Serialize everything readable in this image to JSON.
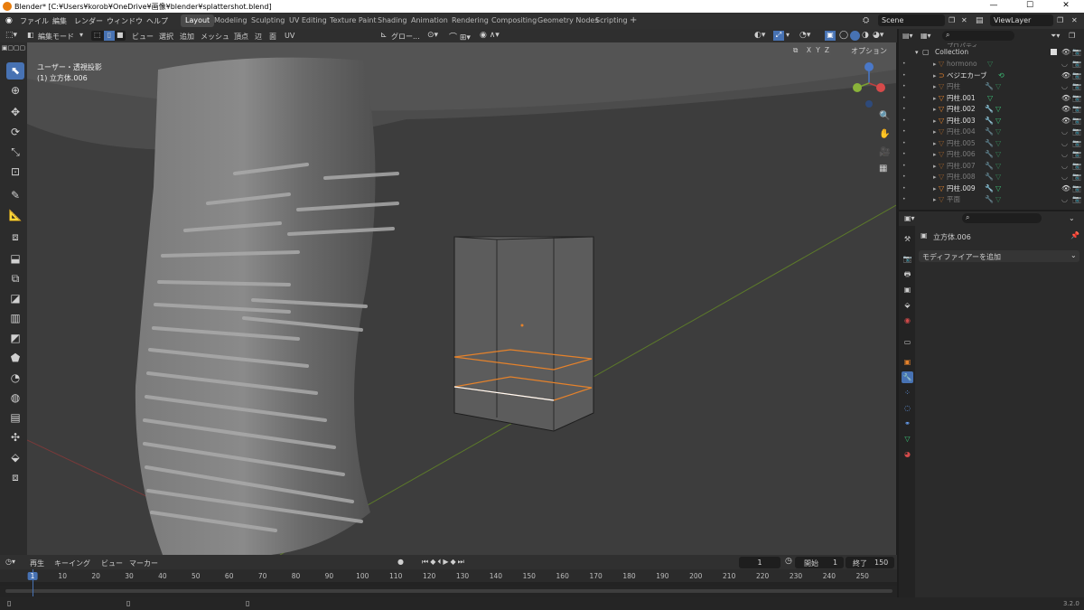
{
  "title": "Blender* [C:¥Users¥korob¥OneDrive¥画像¥blender¥splattershot.blend]",
  "window_controls": [
    "—",
    "☐",
    "✕"
  ],
  "menus": [
    "ファイル",
    "編集",
    "レンダー",
    "ウィンドウ",
    "ヘルプ"
  ],
  "workspaces": [
    "Layout",
    "Modeling",
    "Sculpting",
    "UV Editing",
    "Texture Paint",
    "Shading",
    "Animation",
    "Rendering",
    "Compositing",
    "Geometry Nodes",
    "Scripting",
    "+"
  ],
  "active_workspace": "Layout",
  "scene": "Scene",
  "view_layer": "ViewLayer",
  "viewport_header": {
    "mode": "編集モード",
    "menus": [
      "ビュー",
      "選択",
      "追加",
      "メッシュ",
      "頂点",
      "辺",
      "面",
      "UV"
    ],
    "transform": "グロー...",
    "options": "オプション",
    "axes": [
      "X",
      "Y",
      "Z"
    ]
  },
  "viewport_info": {
    "view": "ユーザー・透視投影",
    "object": "(1) 立方体.006"
  },
  "outliner": {
    "collection": "Collection",
    "partial_top": "プロパティ",
    "items": [
      {
        "name": "hormono",
        "dim": true,
        "mod": false,
        "eye": false
      },
      {
        "name": "ベジエカーブ",
        "dim": false,
        "mod": false,
        "eye": true,
        "curve": true
      },
      {
        "name": "円柱",
        "dim": true,
        "mod": true,
        "eye": false
      },
      {
        "name": "円柱.001",
        "dim": false,
        "mod": false,
        "eye": true
      },
      {
        "name": "円柱.002",
        "dim": false,
        "mod": true,
        "eye": true
      },
      {
        "name": "円柱.003",
        "dim": false,
        "mod": true,
        "eye": true
      },
      {
        "name": "円柱.004",
        "dim": true,
        "mod": true,
        "eye": false
      },
      {
        "name": "円柱.005",
        "dim": true,
        "mod": true,
        "eye": false
      },
      {
        "name": "円柱.006",
        "dim": true,
        "mod": true,
        "eye": false
      },
      {
        "name": "円柱.007",
        "dim": true,
        "mod": true,
        "eye": false
      },
      {
        "name": "円柱.008",
        "dim": true,
        "mod": true,
        "eye": false
      },
      {
        "name": "円柱.009",
        "dim": false,
        "mod": true,
        "eye": true
      },
      {
        "name": "平面",
        "dim": true,
        "mod": true,
        "eye": false
      }
    ]
  },
  "properties": {
    "object_name": "立方体.006",
    "add_modifier": "モディファイアーを追加"
  },
  "timeline": {
    "menus": [
      "再生",
      "キーイング",
      "ビュー",
      "マーカー"
    ],
    "current_frame": "1",
    "start_label": "開始",
    "start": "1",
    "end_label": "終了",
    "end": "150",
    "ticks": [
      "1",
      "10",
      "20",
      "30",
      "40",
      "50",
      "60",
      "70",
      "80",
      "90",
      "100",
      "110",
      "120",
      "130",
      "140",
      "150",
      "160",
      "170",
      "180",
      "190",
      "200",
      "210",
      "220",
      "230",
      "240",
      "250"
    ]
  },
  "version": "3.2.0",
  "colors": {
    "accent": "#4772b3",
    "orange": "#e5822b",
    "green_axis": "#6a8f2c",
    "red_axis": "#a23a3a"
  }
}
